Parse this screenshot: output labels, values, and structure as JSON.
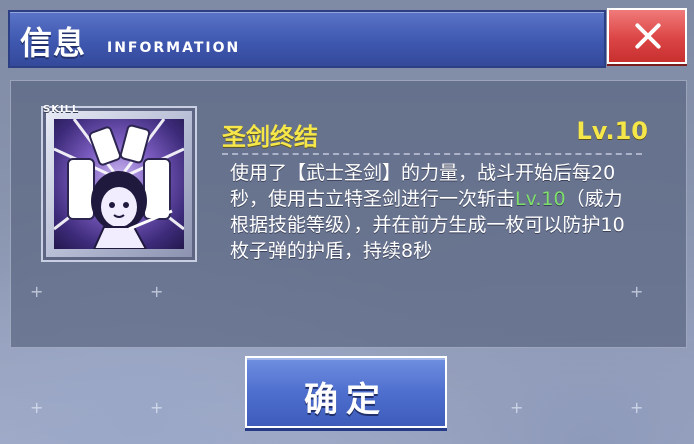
{
  "header": {
    "title": "信息",
    "subtitle": "INFORMATION",
    "close_icon": "close-icon"
  },
  "skill": {
    "tag": "SKILL",
    "name": "圣剑终结",
    "level": "Lv.10",
    "description": {
      "part1": "使用了【武士圣剑】的力量，战斗开始后每20秒，使用古立特圣剑进行一次斩击",
      "highlight": "Lv.10",
      "part2": "（威力根据技能等级），并在前方生成一枚可以防护10枚子弹的护盾，持续8秒"
    }
  },
  "footer": {
    "confirm_label": "确定"
  },
  "colors": {
    "header_blue": "#3f58b0",
    "close_red": "#dc4545",
    "title_yellow": "#f5e64a",
    "highlight_green": "#7ee06b"
  }
}
